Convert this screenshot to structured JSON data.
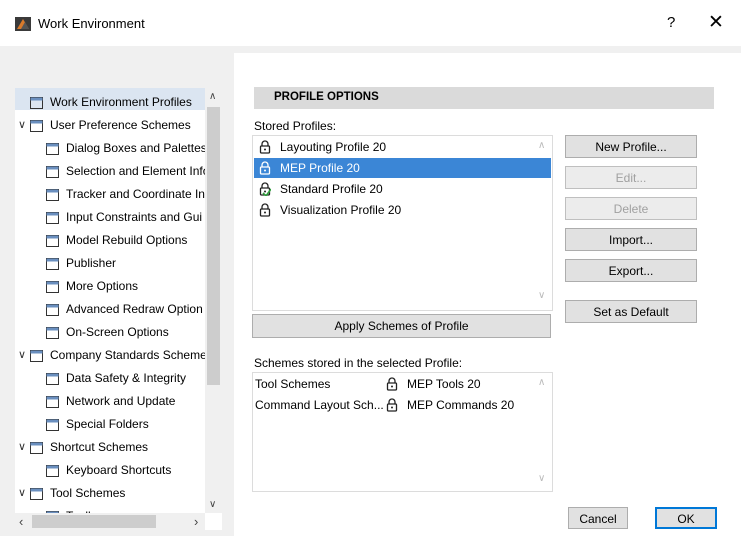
{
  "window": {
    "title": "Work Environment",
    "help": "?",
    "close": "✕"
  },
  "tree": {
    "items": [
      {
        "label": "Work Environment Profiles",
        "icon": "monitor-icon",
        "indent": 0,
        "twisty": ""
      },
      {
        "label": "User Preference Schemes",
        "icon": "user-prefs-icon",
        "indent": 0,
        "twisty": "∨"
      },
      {
        "label": "Dialog Boxes and Palettes",
        "icon": "dialog-icon",
        "indent": 1,
        "twisty": ""
      },
      {
        "label": "Selection and Element Info",
        "icon": "selection-icon",
        "indent": 1,
        "twisty": ""
      },
      {
        "label": "Tracker and Coordinate In",
        "icon": "tracker-icon",
        "indent": 1,
        "twisty": ""
      },
      {
        "label": "Input Constraints and Gui",
        "icon": "constraints-icon",
        "indent": 1,
        "twisty": ""
      },
      {
        "label": "Model Rebuild Options",
        "icon": "rebuild-icon",
        "indent": 1,
        "twisty": ""
      },
      {
        "label": "Publisher",
        "icon": "publisher-icon",
        "indent": 1,
        "twisty": ""
      },
      {
        "label": "More Options",
        "icon": "sliders-icon",
        "indent": 1,
        "twisty": ""
      },
      {
        "label": "Advanced Redraw Option",
        "icon": "redraw-icon",
        "indent": 1,
        "twisty": ""
      },
      {
        "label": "On-Screen Options",
        "icon": "onscreen-icon",
        "indent": 1,
        "twisty": ""
      },
      {
        "label": "Company Standards Scheme",
        "icon": "company-icon",
        "indent": 0,
        "twisty": "∨"
      },
      {
        "label": "Data Safety & Integrity",
        "icon": "data-safety-icon",
        "indent": 1,
        "twisty": ""
      },
      {
        "label": "Network and Update",
        "icon": "globe-icon",
        "indent": 1,
        "twisty": ""
      },
      {
        "label": "Special Folders",
        "icon": "folder-icon",
        "indent": 1,
        "twisty": ""
      },
      {
        "label": "Shortcut Schemes",
        "icon": "shortcut-icon",
        "indent": 0,
        "twisty": "∨"
      },
      {
        "label": "Keyboard Shortcuts",
        "icon": "keyboard-icon",
        "indent": 1,
        "twisty": ""
      },
      {
        "label": "Tool Schemes",
        "icon": "tool-icon",
        "indent": 0,
        "twisty": "∨"
      },
      {
        "label": "Toolbox",
        "icon": "toolbox-icon",
        "indent": 1,
        "twisty": ""
      }
    ],
    "selected_index": 0
  },
  "options": {
    "header": "PROFILE OPTIONS",
    "stored_label": "Stored Profiles:",
    "profiles": [
      {
        "name": "Layouting Profile 20",
        "icon": "lock-icon"
      },
      {
        "name": "MEP Profile 20",
        "icon": "lock-icon"
      },
      {
        "name": "Standard Profile 20",
        "icon": "lock-check-icon"
      },
      {
        "name": "Visualization Profile 20",
        "icon": "lock-icon"
      }
    ],
    "selected_profile": 1,
    "apply_button": "Apply Schemes of Profile",
    "schemes_label": "Schemes stored in the selected Profile:",
    "schemes": [
      {
        "type": "Tool Schemes",
        "value": "MEP Tools 20"
      },
      {
        "type": "Command Layout Sch...",
        "value": "MEP Commands 20"
      }
    ]
  },
  "buttons": {
    "new_profile": "New Profile...",
    "edit": "Edit...",
    "delete": "Delete",
    "import": "Import...",
    "export": "Export...",
    "set_default": "Set as Default",
    "cancel": "Cancel",
    "ok": "OK"
  },
  "colors": {
    "selection": "#3b86d6",
    "accent": "#0078d7",
    "section": "#dadada"
  }
}
